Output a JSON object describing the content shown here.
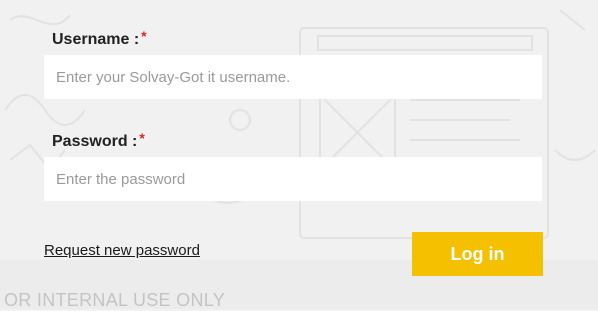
{
  "form": {
    "username": {
      "label": "Username :",
      "required_mark": "*",
      "placeholder": "Enter your Solvay-Got it username."
    },
    "password": {
      "label": "Password :",
      "required_mark": "*",
      "placeholder": "Enter the password"
    },
    "request_password_link": "Request new password",
    "login_button": "Log in"
  },
  "footer": {
    "note": "OR INTERNAL USE ONLY"
  },
  "colors": {
    "accent": "#f5c000",
    "required": "#d9261c",
    "background": "#f1f1f1"
  }
}
